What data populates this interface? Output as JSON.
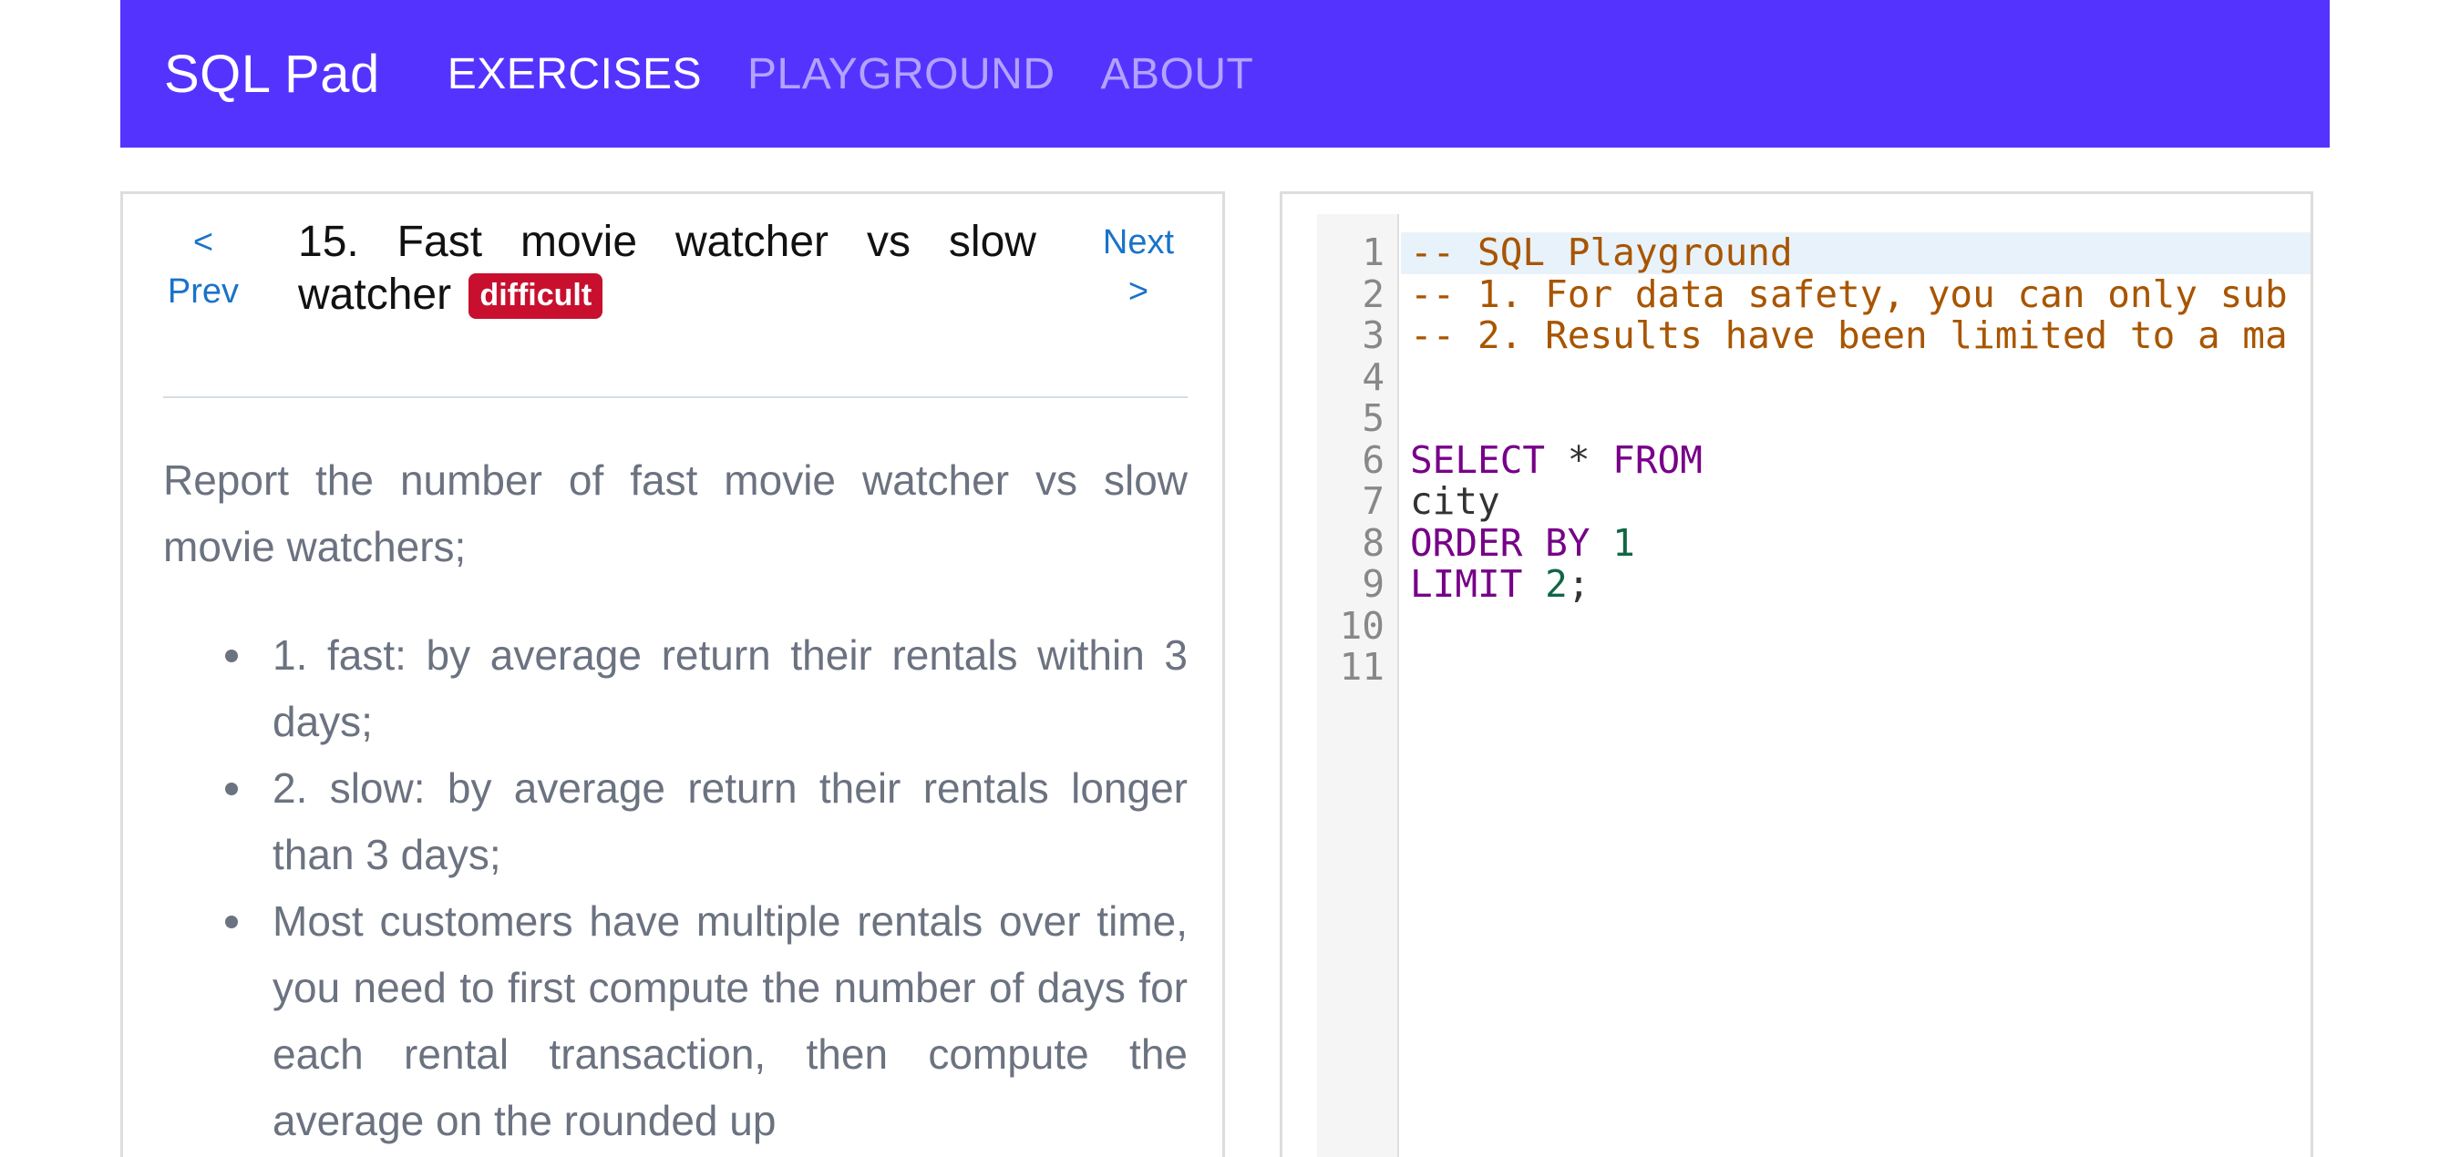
{
  "navbar": {
    "brand": "SQL Pad",
    "links": [
      {
        "label": "EXERCISES",
        "active": true
      },
      {
        "label": "PLAYGROUND",
        "active": false
      },
      {
        "label": "ABOUT",
        "active": false
      }
    ],
    "bg_color": "#5533ff"
  },
  "exercise": {
    "prev_label": "<",
    "prev_text": "Prev",
    "next_text": "Next",
    "next_label": ">",
    "title_line1_words": [
      "15.",
      "Fast",
      "movie",
      "watcher",
      "vs",
      "slow"
    ],
    "title_line2": "watcher",
    "difficulty": "difficult",
    "difficulty_color": "#c8102e",
    "description": "Report the number of fast movie watcher vs slow movie watchers;",
    "bullets": [
      "1. fast: by average return their rentals within 3 days;",
      "2. slow: by average return their rentals longer than 3 days;",
      "Most customers have multiple rentals over time, you need to first compute the number of days for each rental transaction, then compute the average on the rounded up"
    ]
  },
  "editor": {
    "line_numbers": [
      "1",
      "2",
      "3",
      "4",
      "5",
      "6",
      "7",
      "8",
      "9",
      "10",
      "11"
    ],
    "lines": [
      [
        {
          "t": "comment",
          "v": "-- SQL Playground"
        }
      ],
      [
        {
          "t": "comment",
          "v": "-- 1. For data safety, you can only sub"
        }
      ],
      [
        {
          "t": "comment",
          "v": "-- 2. Results have been limited to a ma"
        }
      ],
      [],
      [],
      [
        {
          "t": "keyword",
          "v": "SELECT"
        },
        {
          "t": "plain",
          "v": " "
        },
        {
          "t": "operator",
          "v": "*"
        },
        {
          "t": "plain",
          "v": " "
        },
        {
          "t": "keyword",
          "v": "FROM"
        }
      ],
      [
        {
          "t": "plain",
          "v": "city"
        }
      ],
      [
        {
          "t": "keyword",
          "v": "ORDER BY"
        },
        {
          "t": "plain",
          "v": " "
        },
        {
          "t": "number",
          "v": "1"
        }
      ],
      [
        {
          "t": "keyword",
          "v": "LIMIT"
        },
        {
          "t": "plain",
          "v": " "
        },
        {
          "t": "number",
          "v": "2"
        },
        {
          "t": "plain",
          "v": ";"
        }
      ],
      [],
      []
    ]
  }
}
